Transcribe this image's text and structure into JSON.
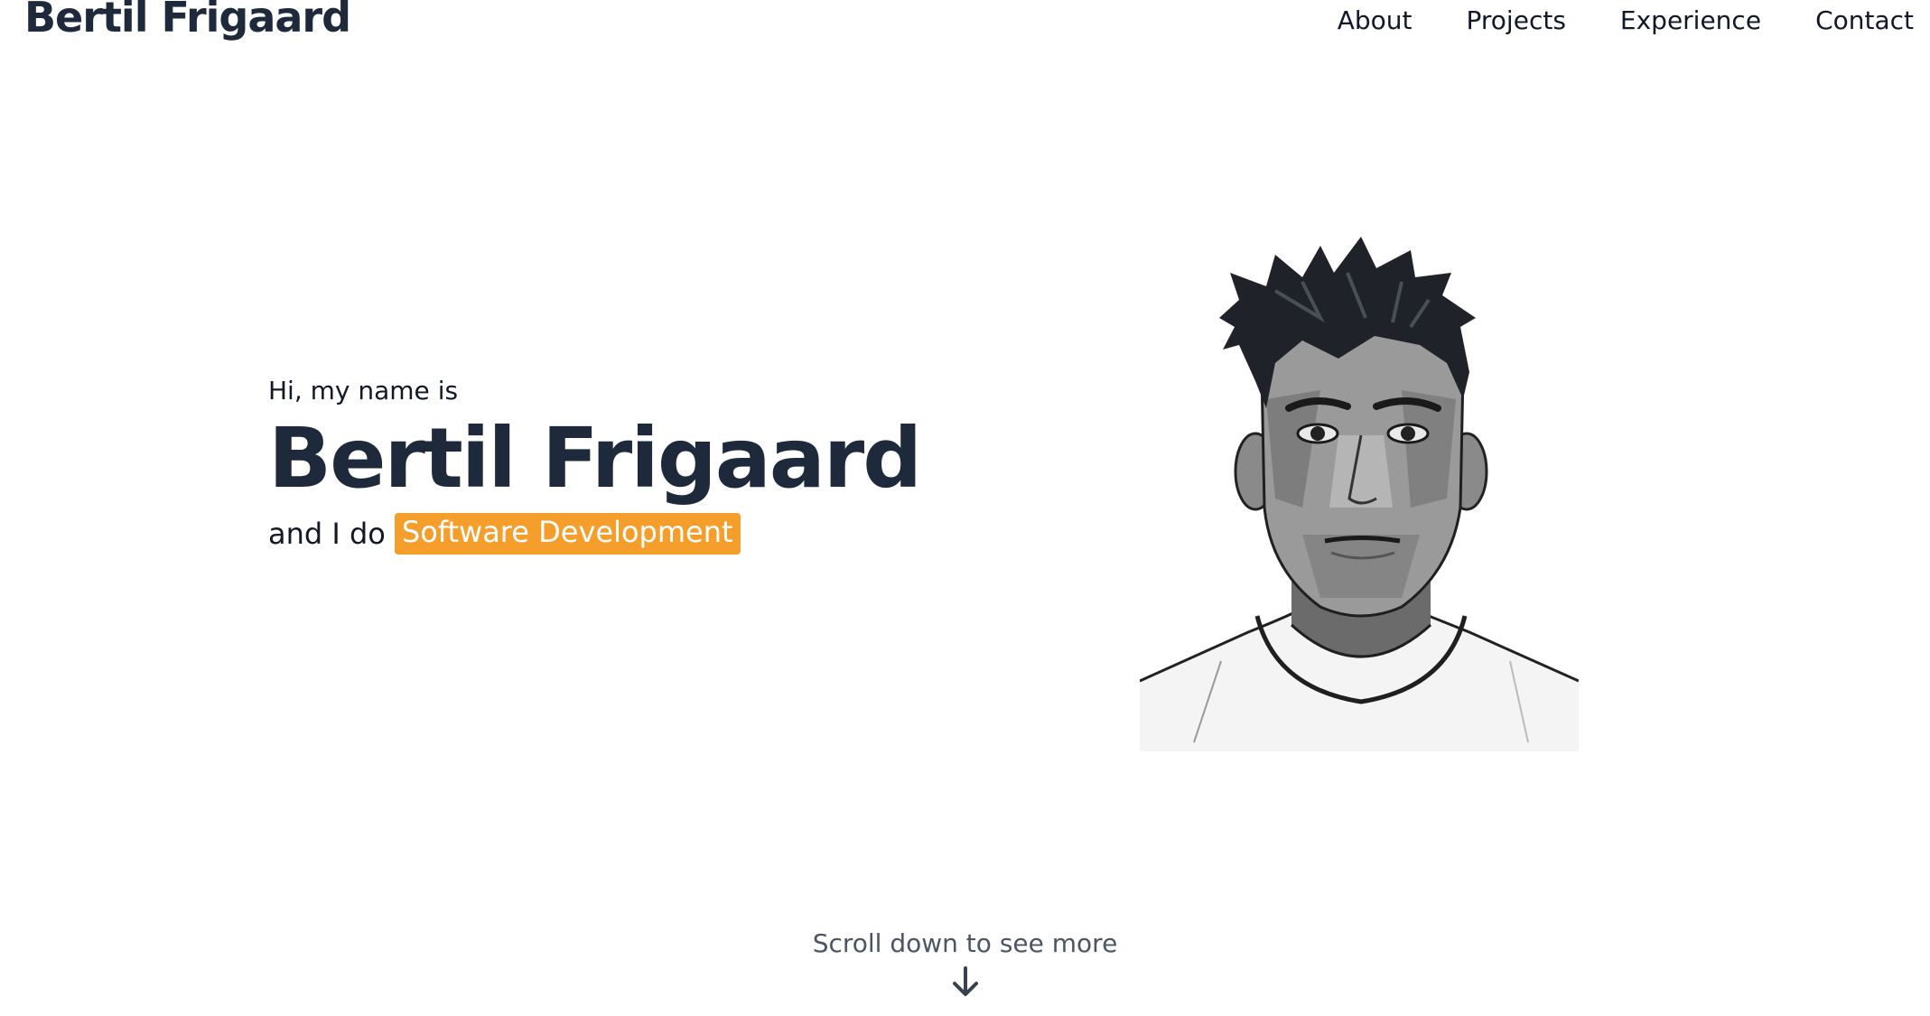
{
  "header": {
    "brand": "Bertil Frigaard",
    "nav": [
      {
        "label": "About"
      },
      {
        "label": "Projects"
      },
      {
        "label": "Experience"
      },
      {
        "label": "Contact"
      }
    ]
  },
  "hero": {
    "greeting": "Hi, my name is",
    "name": "Bertil Frigaard",
    "tagline_prefix": "and I do",
    "tagline_highlight": "Software Development",
    "portrait_icon": "portrait-illustration"
  },
  "scroll": {
    "text": "Scroll down to see more",
    "icon": "arrow-down-icon"
  },
  "colors": {
    "accent": "#f59e2b",
    "heading": "#1e293b",
    "muted": "#4b5563",
    "background": "#ffffff"
  }
}
